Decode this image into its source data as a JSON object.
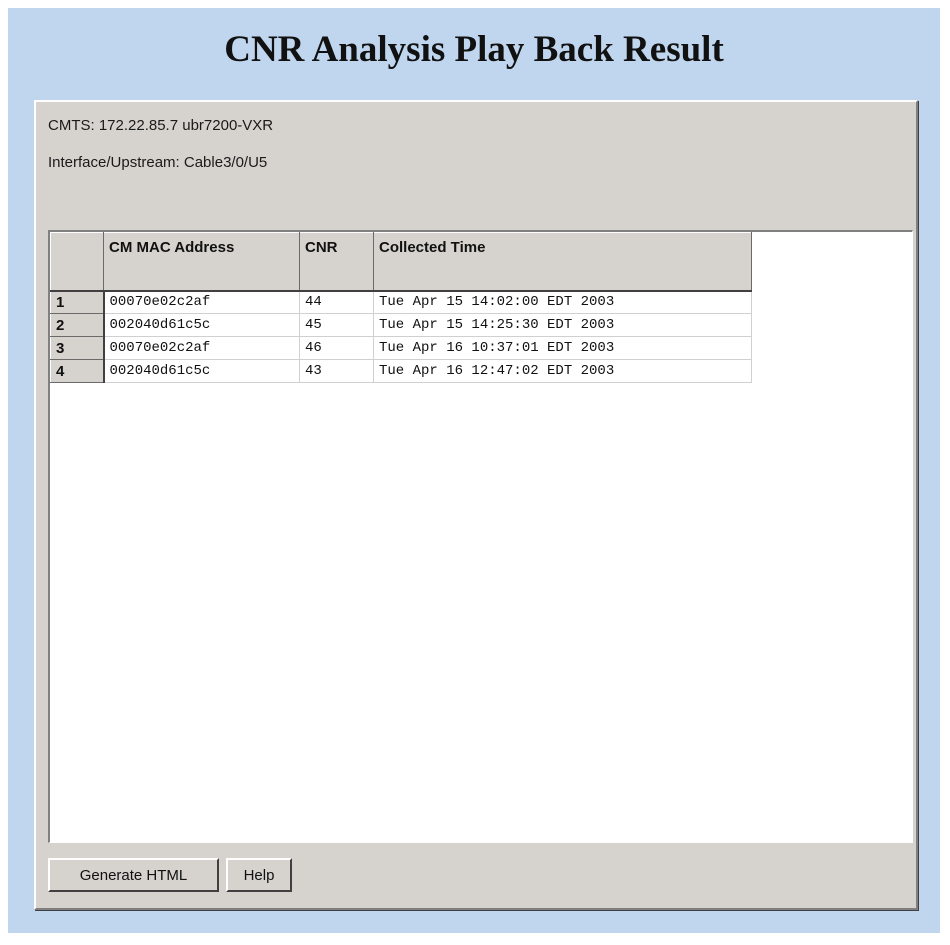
{
  "page": {
    "title": "CNR Analysis Play Back Result"
  },
  "info": {
    "cmts": "CMTS: 172.22.85.7 ubr7200-VXR",
    "interface": "Interface/Upstream: Cable3/0/U5"
  },
  "table": {
    "columns": [
      "",
      "CM MAC Address",
      "CNR",
      "Collected Time"
    ],
    "rows": [
      {
        "num": "1",
        "mac": "00070e02c2af",
        "cnr": "44",
        "time": "Tue Apr 15 14:02:00 EDT 2003"
      },
      {
        "num": "2",
        "mac": "002040d61c5c",
        "cnr": "45",
        "time": "Tue Apr 15 14:25:30 EDT 2003"
      },
      {
        "num": "3",
        "mac": "00070e02c2af",
        "cnr": "46",
        "time": "Tue Apr 16 10:37:01 EDT 2003"
      },
      {
        "num": "4",
        "mac": "002040d61c5c",
        "cnr": "43",
        "time": "Tue Apr 16 12:47:02 EDT 2003"
      }
    ]
  },
  "buttons": {
    "generate": "Generate HTML",
    "help": "Help"
  }
}
